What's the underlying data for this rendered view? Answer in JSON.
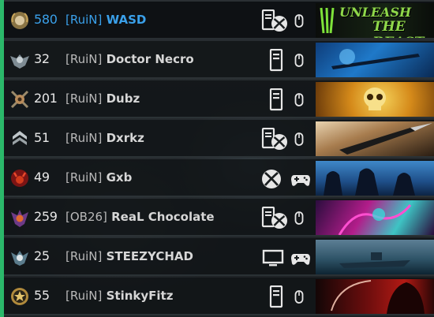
{
  "players": [
    {
      "level": "580",
      "clan": "[RuiN]",
      "name": "WASD",
      "platform": "pc-xbox",
      "input": "mouse",
      "emblem": "laurel-skull",
      "card": "monster",
      "highlight": true
    },
    {
      "level": "32",
      "clan": "[RuiN]",
      "name": "Doctor Necro",
      "platform": "pc",
      "input": "mouse",
      "emblem": "winged-skull",
      "card": "sniper-blue",
      "highlight": false
    },
    {
      "level": "201",
      "clan": "[RuiN]",
      "name": "Dubz",
      "platform": "pc",
      "input": "mouse",
      "emblem": "crossed-blades",
      "card": "gold-skull",
      "highlight": false
    },
    {
      "level": "51",
      "clan": "[RuiN]",
      "name": "Dxrkz",
      "platform": "pc-xbox",
      "input": "mouse",
      "emblem": "chevron-stack",
      "card": "knife",
      "highlight": false
    },
    {
      "level": "49",
      "clan": "[RuiN]",
      "name": "Gxb",
      "platform": "xbox",
      "input": "controller",
      "emblem": "red-demon",
      "card": "silhouettes",
      "highlight": false
    },
    {
      "level": "259",
      "clan": "[OB26]",
      "name": "ReaL Chocolate",
      "platform": "pc-xbox",
      "input": "mouse",
      "emblem": "purple-skull",
      "card": "neon-purple",
      "highlight": false
    },
    {
      "level": "25",
      "clan": "[RuiN]",
      "name": "STEEZYCHAD",
      "platform": "tv",
      "input": "controller",
      "emblem": "winged-mask",
      "card": "ship",
      "highlight": false
    },
    {
      "level": "55",
      "clan": "[RuiN]",
      "name": "StinkyFitz",
      "platform": "pc",
      "input": "mouse",
      "emblem": "gold-medal",
      "card": "red-reaper",
      "highlight": false
    }
  ],
  "card_text": {
    "line1": "UNLEASH",
    "line2": "THE BEAST"
  },
  "colors": {
    "accent": "#2bb86a",
    "highlight_text": "#3aa0ea"
  }
}
